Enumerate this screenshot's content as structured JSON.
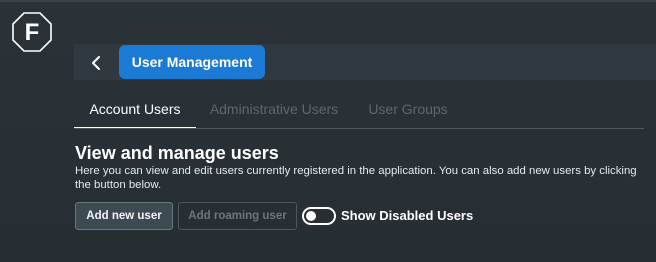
{
  "app": {
    "logo_letter": "F"
  },
  "header": {
    "title": "User Management"
  },
  "tabs": [
    {
      "label": "Account Users",
      "active": true
    },
    {
      "label": "Administrative Users",
      "active": false
    },
    {
      "label": "User Groups",
      "active": false
    }
  ],
  "section": {
    "title": "View and manage users",
    "description": "Here you can view and edit users currently registered in the application. You can also add new users by clicking the button below."
  },
  "actions": {
    "add_user_label": "Add new user",
    "add_roaming_label": "Add roaming user",
    "show_disabled_label": "Show Disabled Users",
    "show_disabled_checked": false
  },
  "colors": {
    "accent": "#1a7ad4",
    "background": "#283036"
  }
}
